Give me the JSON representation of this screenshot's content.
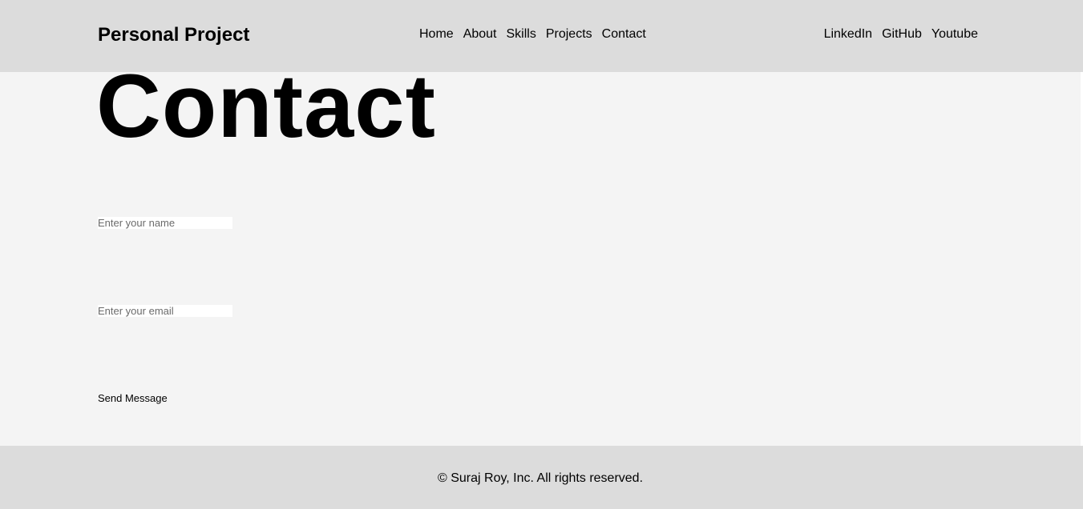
{
  "header": {
    "brand": "Personal Project",
    "nav": [
      {
        "label": "Home"
      },
      {
        "label": "About"
      },
      {
        "label": "Skills"
      },
      {
        "label": "Projects"
      },
      {
        "label": "Contact"
      }
    ],
    "social": [
      {
        "label": "LinkedIn"
      },
      {
        "label": "GitHub"
      },
      {
        "label": "Youtube"
      }
    ]
  },
  "main": {
    "title": "Contact",
    "form": {
      "name_placeholder": "Enter your name",
      "name_value": "",
      "email_placeholder": "Enter your email",
      "email_value": "",
      "submit_label": "Send Message"
    }
  },
  "footer": {
    "copyright": "© Suraj Roy, Inc. All rights reserved."
  },
  "colors": {
    "header_bg": "#dcdcdc",
    "page_bg": "#f4f4f4",
    "text": "#000000"
  }
}
